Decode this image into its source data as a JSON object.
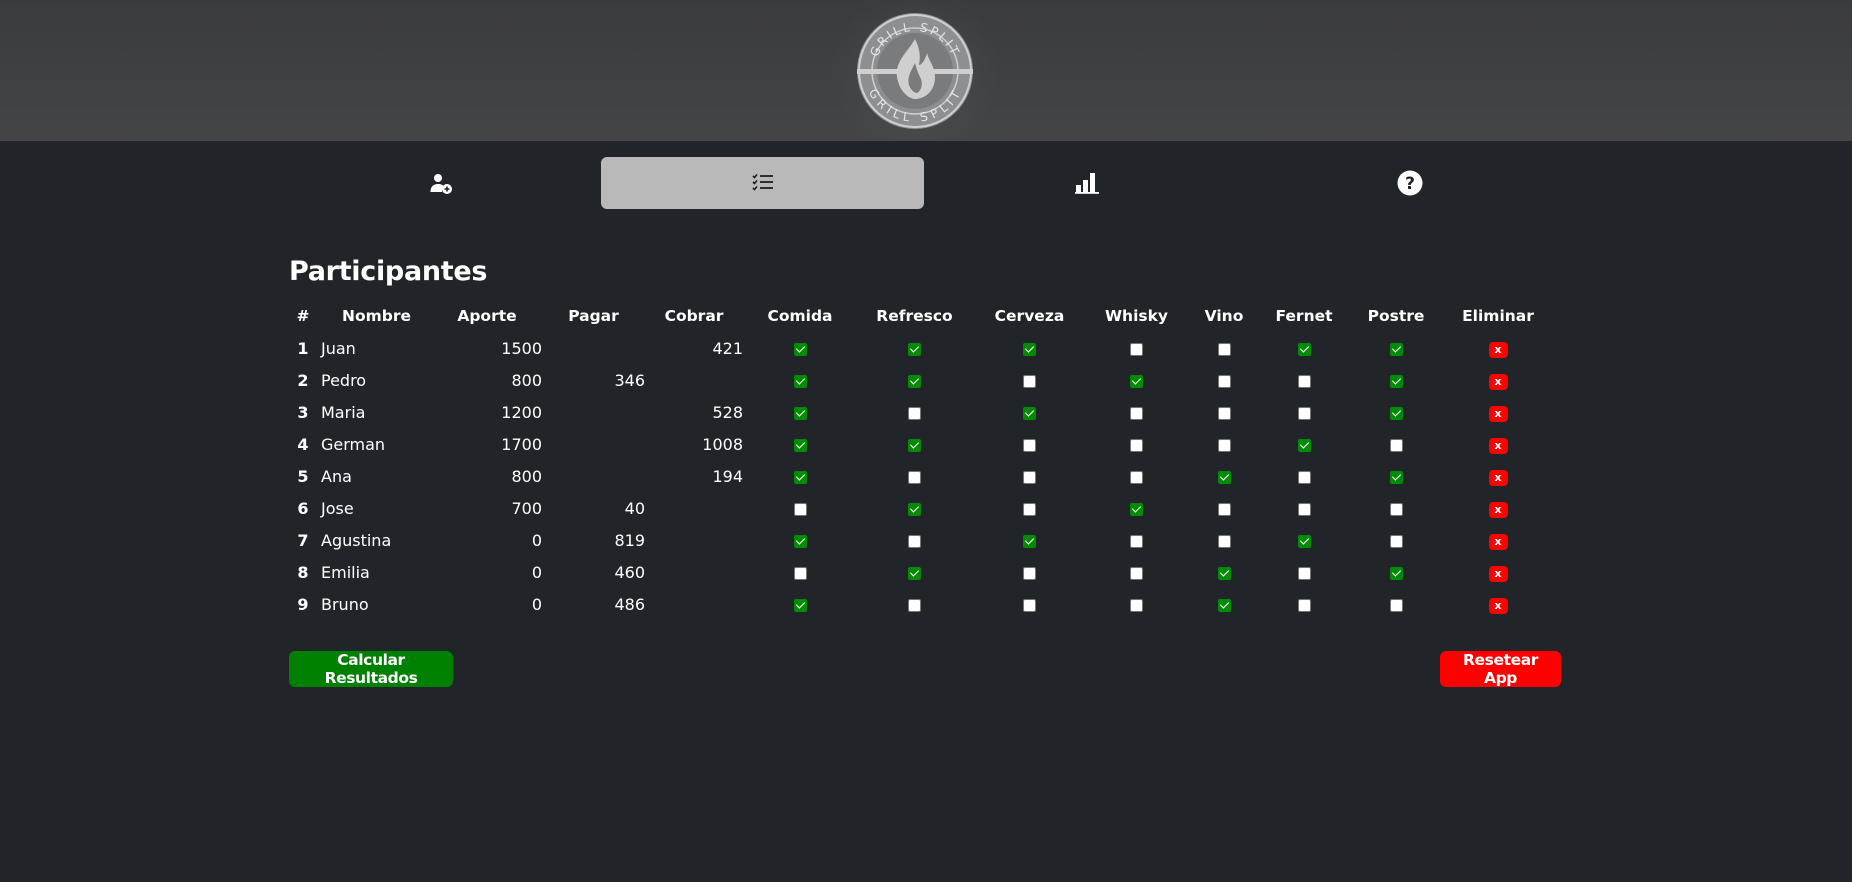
{
  "logo": {
    "text_top": "GRILL SPLIT",
    "text_bottom": "GRILL SPLIT"
  },
  "nav": [
    {
      "icon": "add-user-icon",
      "active": false
    },
    {
      "icon": "checklist-icon",
      "active": true
    },
    {
      "icon": "bar-chart-icon",
      "active": false
    },
    {
      "icon": "help-icon",
      "active": false
    }
  ],
  "page": {
    "title": "Participantes"
  },
  "table": {
    "headers": [
      "#",
      "Nombre",
      "Aporte",
      "Pagar",
      "Cobrar",
      "Comida",
      "Refresco",
      "Cerveza",
      "Whisky",
      "Vino",
      "Fernet",
      "Postre",
      "Eliminar"
    ],
    "delete_label": "x",
    "rows": [
      {
        "num": "1",
        "name": "Juan",
        "aporte": "1500",
        "pagar": "",
        "cobrar": "421",
        "checks": [
          true,
          true,
          true,
          false,
          false,
          true,
          true
        ]
      },
      {
        "num": "2",
        "name": "Pedro",
        "aporte": "800",
        "pagar": "346",
        "cobrar": "",
        "checks": [
          true,
          true,
          false,
          true,
          false,
          false,
          true
        ]
      },
      {
        "num": "3",
        "name": "Maria",
        "aporte": "1200",
        "pagar": "",
        "cobrar": "528",
        "checks": [
          true,
          false,
          true,
          false,
          false,
          false,
          true
        ]
      },
      {
        "num": "4",
        "name": "German",
        "aporte": "1700",
        "pagar": "",
        "cobrar": "1008",
        "checks": [
          true,
          true,
          false,
          false,
          false,
          true,
          false
        ]
      },
      {
        "num": "5",
        "name": "Ana",
        "aporte": "800",
        "pagar": "",
        "cobrar": "194",
        "checks": [
          true,
          false,
          false,
          false,
          true,
          false,
          true
        ]
      },
      {
        "num": "6",
        "name": "Jose",
        "aporte": "700",
        "pagar": "40",
        "cobrar": "",
        "checks": [
          false,
          true,
          false,
          true,
          false,
          false,
          false
        ]
      },
      {
        "num": "7",
        "name": "Agustina",
        "aporte": "0",
        "pagar": "819",
        "cobrar": "",
        "checks": [
          true,
          false,
          true,
          false,
          false,
          true,
          false
        ]
      },
      {
        "num": "8",
        "name": "Emilia",
        "aporte": "0",
        "pagar": "460",
        "cobrar": "",
        "checks": [
          false,
          true,
          false,
          false,
          true,
          false,
          true
        ]
      },
      {
        "num": "9",
        "name": "Bruno",
        "aporte": "0",
        "pagar": "486",
        "cobrar": "",
        "checks": [
          true,
          false,
          false,
          false,
          true,
          false,
          false
        ]
      }
    ]
  },
  "actions": {
    "calculate_label": "Calcular Resultados",
    "reset_label": "Resetear App"
  },
  "colors": {
    "accent_green": "#008000",
    "danger_red": "#ff0000",
    "background": "#212429",
    "active_tab": "#b9b9b9"
  }
}
